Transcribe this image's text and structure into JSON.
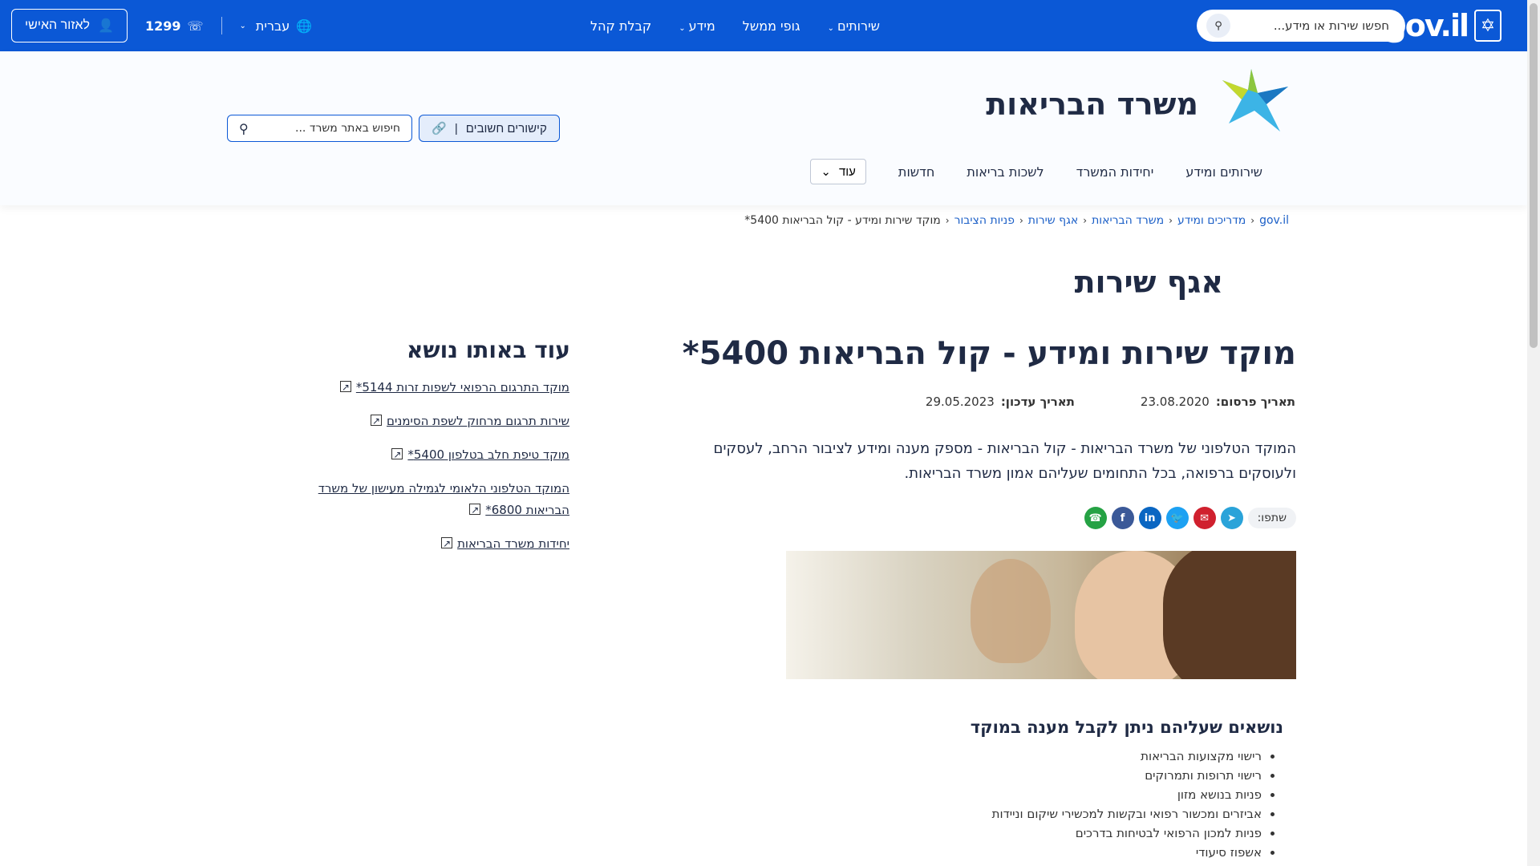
{
  "topbar": {
    "logo_text": "gov.il",
    "search_placeholder": "חפשו שירות או מידע...",
    "nav": [
      {
        "label": "שירותים",
        "has_dropdown": true
      },
      {
        "label": "גופי ממשל",
        "has_dropdown": false
      },
      {
        "label": "מידע",
        "has_dropdown": true
      },
      {
        "label": "קבלת קהל",
        "has_dropdown": false
      }
    ],
    "language": "עברית",
    "phone": "1299",
    "personal_area": "לאזור האישי"
  },
  "ministry": {
    "title": "משרד הבריאות",
    "subnav": [
      "שירותים ומידע",
      "יחידות המשרד",
      "לשכות בריאות",
      "חדשות"
    ],
    "more_label": "עוד",
    "important_links": "קישורים חשובים",
    "site_search_placeholder": "חיפוש באתר משרד ..."
  },
  "breadcrumb": {
    "items": [
      "gov.il",
      "מדריכים ומידע",
      "משרד הבריאות",
      "אגף שירות",
      "פניות הציבור"
    ],
    "current": "מוקד שירות ומידע - קול הבריאות 5400*"
  },
  "page": {
    "dept_title": "אגף שירות",
    "title": "מוקד שירות ומידע - קול הבריאות 5400*",
    "published_label": "תאריך פרסום:",
    "published": "23.08.2020",
    "updated_label": "תאריך עדכון:",
    "updated": "29.05.2023",
    "intro": "המוקד הטלפוני של משרד הבריאות - קול הבריאות - מספק מענה ומידע לציבור הרחב, לעסקים ולעוסקים ברפואה, בכל התחומים שעליהם אמון משרד הבריאות.",
    "share_label": "שתפו:",
    "topics_title": "נושאים שעליהם ניתן לקבל מענה במוקד",
    "topics": [
      "רישוי מקצועות הבריאות",
      "רישוי תרופות ותמרוקים",
      "פניות בנושא מזון",
      "אביזרים ומכשור רפואי ובקשות למכשירי שיקום וניידות",
      "פניות למכון הרפואי לבטיחות בדרכים",
      "אשפוז סיעודי"
    ]
  },
  "sidebar": {
    "title": "עוד באותו נושא",
    "links": [
      "מוקד התרגום הרפואי לשפות זרות 5144*",
      "שירות תרגום מרחוק לשפת הסימנים",
      "מוקד טיפת חלב בטלפון 5400*",
      "המוקד הטלפוני הלאומי לגמילה מעישון של משרד הבריאות 6800*",
      "יחידות משרד הבריאות"
    ]
  },
  "colors": {
    "brand_blue": "#0b58d6",
    "text_dark": "#1f2a44"
  }
}
